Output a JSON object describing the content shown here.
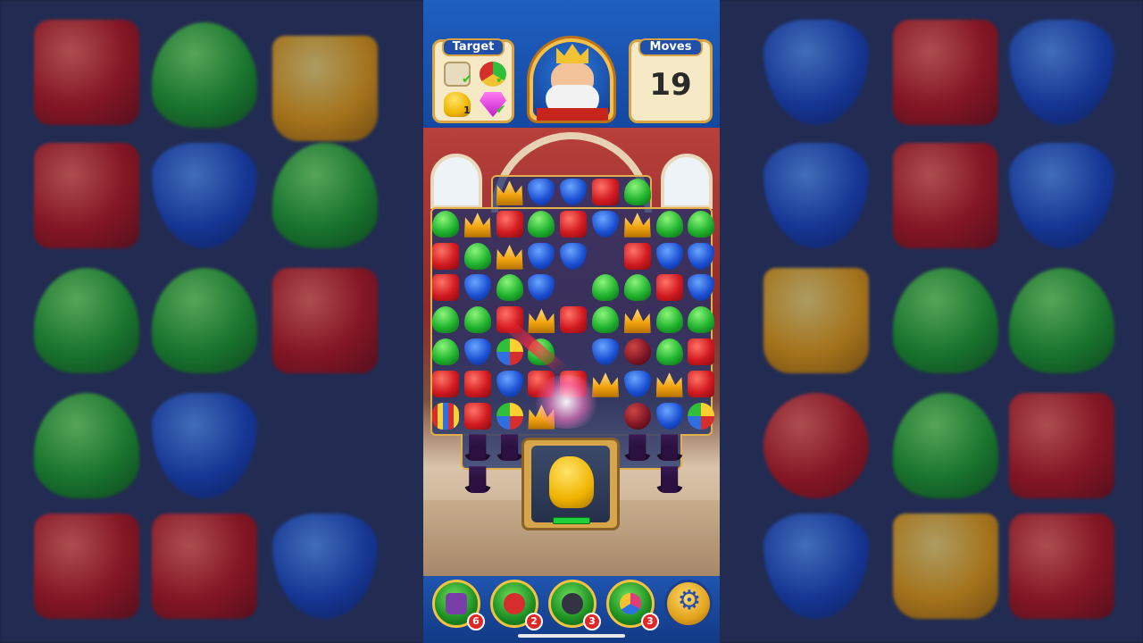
{
  "hud": {
    "target_label": "Target",
    "moves_label": "Moves",
    "moves_count": "19",
    "targets": [
      {
        "icon": "scroll-icon",
        "status": "done"
      },
      {
        "icon": "leaf-gem-icon",
        "status": "done"
      },
      {
        "icon": "duck-icon",
        "count": "1"
      },
      {
        "icon": "pink-gem-icon",
        "status": "done"
      }
    ],
    "check_glyph": "✔"
  },
  "boosters": [
    {
      "name": "hammer-booster",
      "count": "6",
      "color": "#7a3ea8"
    },
    {
      "name": "arrow-booster",
      "count": "2",
      "color": "#d62d2d"
    },
    {
      "name": "cannon-booster",
      "count": "3",
      "color": "#333344"
    },
    {
      "name": "jester-hat-booster",
      "count": "3",
      "color": "#e03b7a"
    }
  ],
  "settings": {
    "glyph": "⚙"
  },
  "colors": {
    "board_border": "#e3b04b",
    "topbar": "#1f5fbf",
    "badge": "#e02626"
  }
}
